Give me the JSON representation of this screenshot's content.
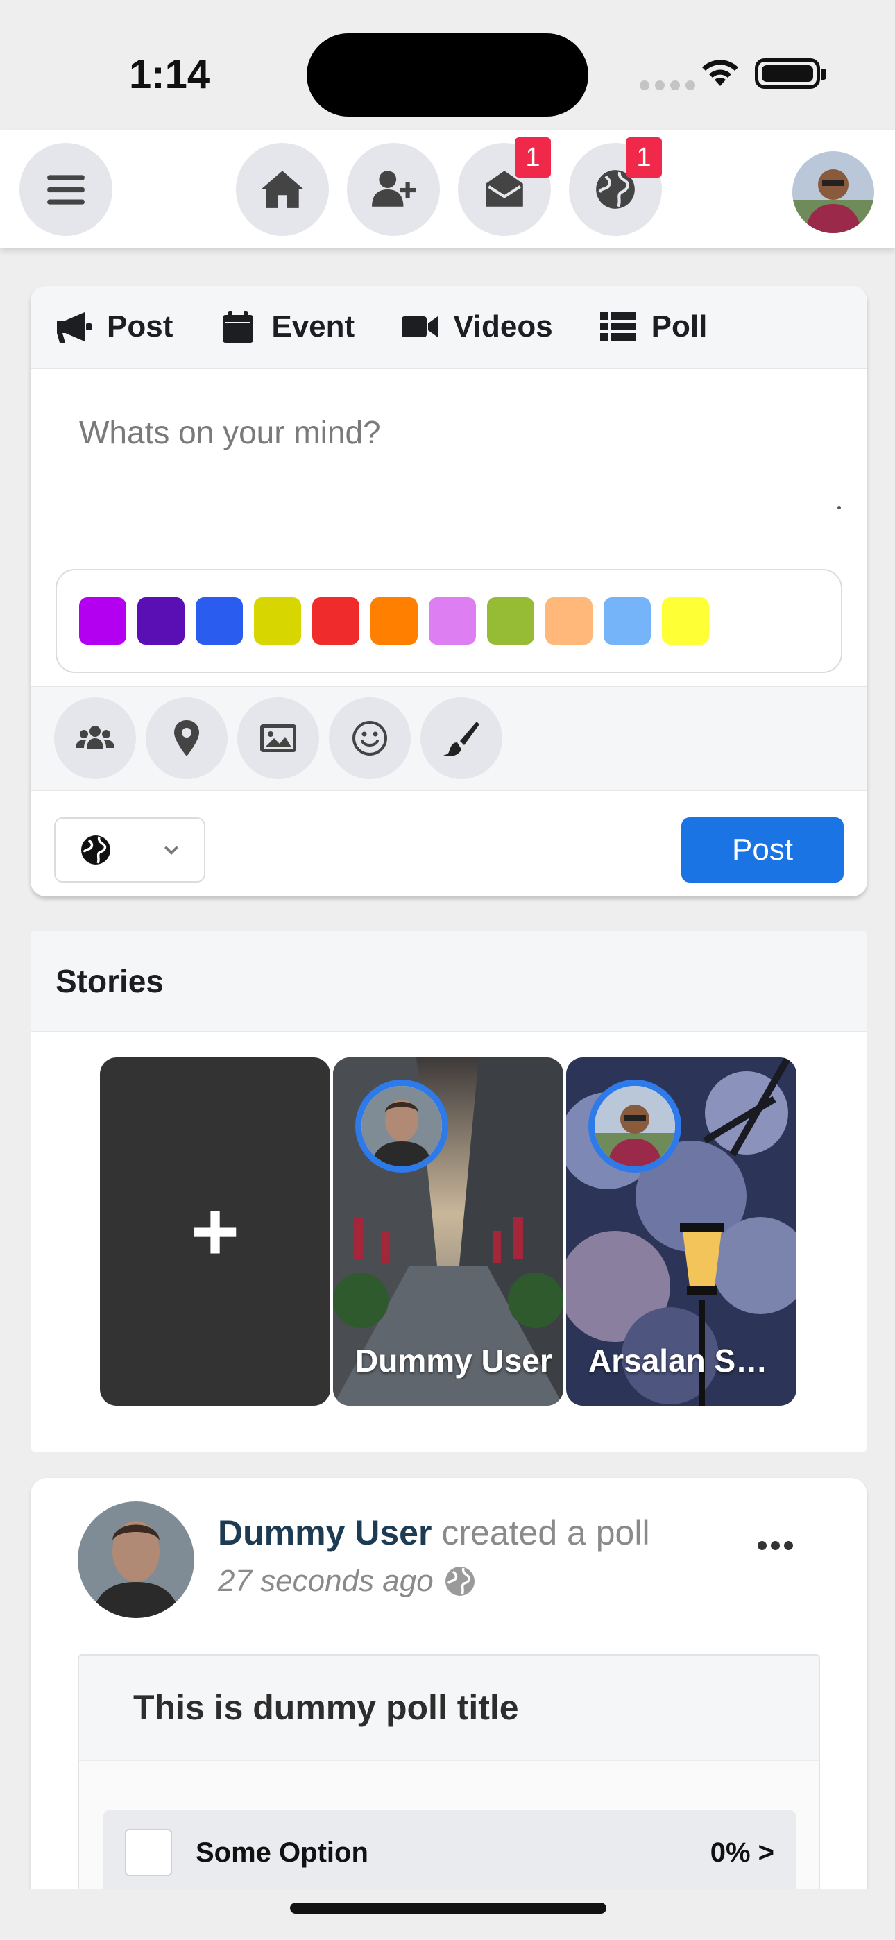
{
  "status_bar": {
    "time": "1:14"
  },
  "nav": {
    "messages_badge": "1",
    "notifications_badge": "1"
  },
  "composer": {
    "tabs": [
      {
        "label": "Post",
        "icon": "megaphone-icon"
      },
      {
        "label": "Event",
        "icon": "calendar-icon"
      },
      {
        "label": "Videos",
        "icon": "video-camera-icon"
      },
      {
        "label": "Poll",
        "icon": "list-icon"
      }
    ],
    "placeholder": "Whats on your mind?",
    "colors": [
      "#b400f0",
      "#5a0fb4",
      "#2b5cf0",
      "#d7d600",
      "#f02b2b",
      "#ff7f00",
      "#dd7ff2",
      "#96bb35",
      "#ffb87a",
      "#76b4fa",
      "#ffff36"
    ],
    "tools": [
      "group-icon",
      "location-pin-icon",
      "image-icon",
      "smiley-icon",
      "paintbrush-icon"
    ],
    "privacy_icon": "globe-icon",
    "post_label": "Post"
  },
  "stories": {
    "title": "Stories",
    "add_label": "+",
    "items": [
      {
        "name": "Dummy User"
      },
      {
        "name": "Arsalan Shah"
      }
    ]
  },
  "post": {
    "author": "Dummy User",
    "action": "created a poll",
    "time": "27 seconds ago",
    "poll": {
      "title": "This is dummy poll title",
      "options": [
        {
          "label": "Some Option",
          "percent": "0% >"
        }
      ]
    }
  }
}
